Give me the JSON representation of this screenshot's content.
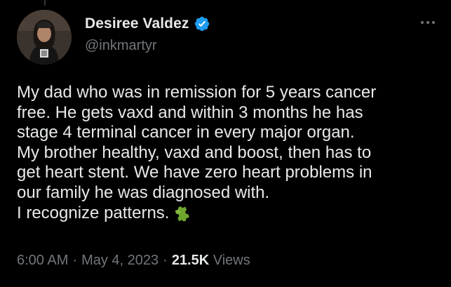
{
  "tweet": {
    "author": {
      "display_name": "Desiree Valdez",
      "handle": "@inkmartyr",
      "verified": true,
      "avatar_icon": "user-avatar-photo",
      "verified_icon": "verified-badge-icon",
      "verified_color": "#1d9bf0"
    },
    "more_icon": "more-options-icon",
    "text_lines": [
      "My dad who was in remission for 5 years cancer",
      "free. He gets vaxd and within 3 months he has",
      "stage 4 terminal cancer in every major organ.",
      "My brother healthy, vaxd and boost, then has to",
      "get heart stent. We have zero heart problems in",
      "our family he was diagnosed with.",
      "I recognize patterns."
    ],
    "trailing_emoji_icon": "puzzle-piece-icon",
    "time": "6:00 AM",
    "separator": "·",
    "date": "May 4, 2023",
    "views_count": "21.5K",
    "views_label": "Views"
  },
  "colors": {
    "background": "#000000",
    "primary_text": "#e7e9ea",
    "secondary_text": "#71767b",
    "accent": "#1d9bf0",
    "emoji_green": "#6ea62e"
  }
}
